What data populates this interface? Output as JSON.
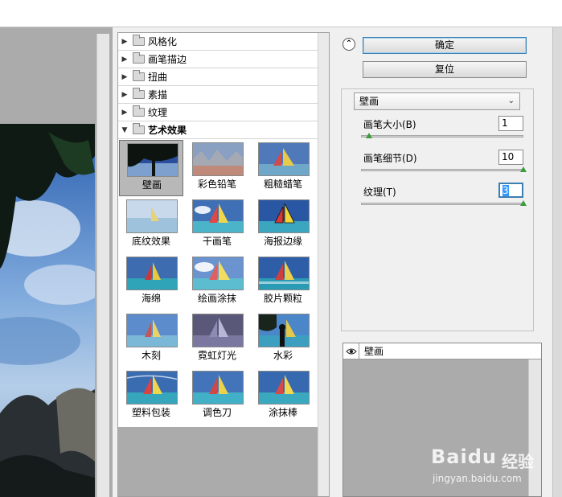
{
  "gallery": {
    "categories": [
      {
        "label": "风格化",
        "open": false
      },
      {
        "label": "画笔描边",
        "open": false
      },
      {
        "label": "扭曲",
        "open": false
      },
      {
        "label": "素描",
        "open": false
      },
      {
        "label": "纹理",
        "open": false
      },
      {
        "label": "艺术效果",
        "open": true
      }
    ],
    "thumbnails": [
      "壁画",
      "彩色铅笔",
      "粗糙蜡笔",
      "底纹效果",
      "干画笔",
      "海报边缘",
      "海绵",
      "绘画涂抹",
      "胶片颗粒",
      "木刻",
      "霓虹灯光",
      "水彩",
      "塑料包装",
      "调色刀",
      "涂抹棒"
    ],
    "selected": "壁画"
  },
  "controls": {
    "ok_label": "确定",
    "reset_label": "复位",
    "filter_select": "壁画",
    "params": [
      {
        "label": "画笔大小(B)",
        "value": "1",
        "level": 0.05
      },
      {
        "label": "画笔细节(D)",
        "value": "10",
        "level": 1.0
      },
      {
        "label": "纹理(T)",
        "value": "3",
        "level": 1.0
      }
    ]
  },
  "layers": {
    "items": [
      {
        "name": "壁画",
        "visible": true
      }
    ]
  },
  "watermark": {
    "logo": "Baidu",
    "text": "经验",
    "url": "jingyan.baidu.com"
  },
  "colors": {
    "slider_thumb": "#3a9b3a",
    "selection": "#3399ff",
    "panel_grey": "#ababab"
  }
}
